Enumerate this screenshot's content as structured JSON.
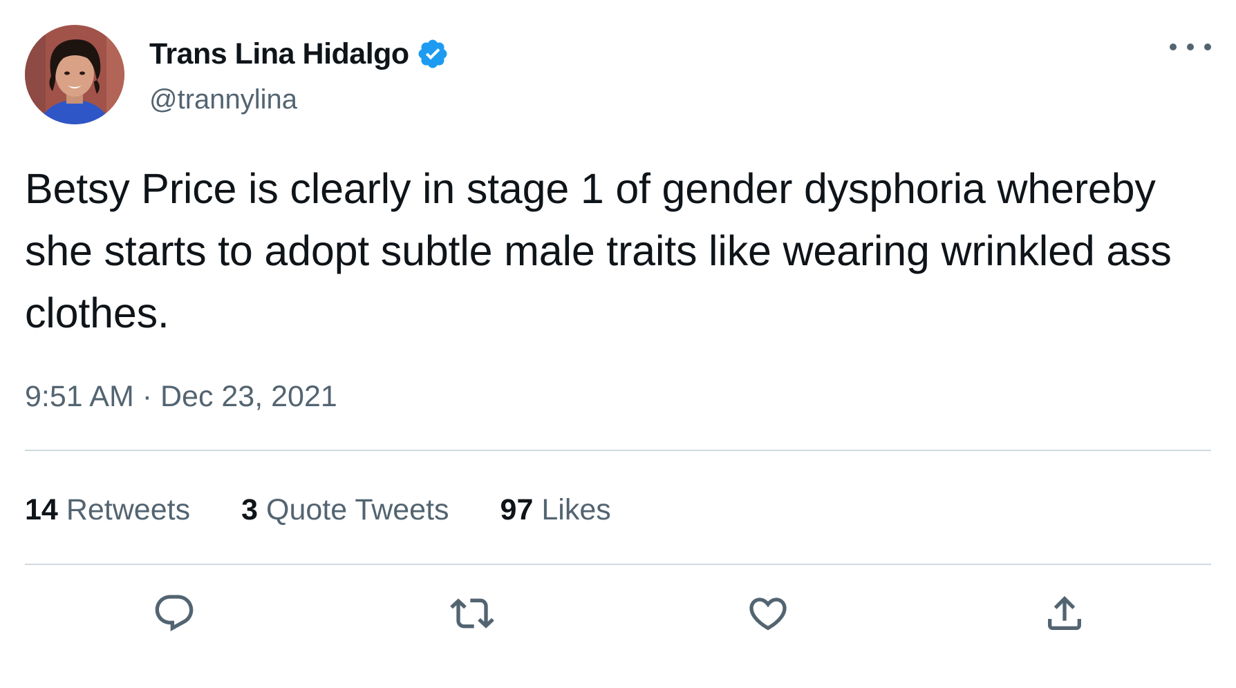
{
  "author": {
    "display_name": "Trans Lina Hidalgo",
    "handle": "@trannylina",
    "verified": true,
    "verified_color": "#1d9bf0"
  },
  "tweet": {
    "text": "Betsy Price is clearly in stage 1 of gender dysphoria whereby she starts to adopt subtle male traits like wearing wrinkled ass clothes.",
    "timestamp": "9:51 AM · Dec 23, 2021"
  },
  "stats": [
    {
      "count": "14",
      "label": "Retweets"
    },
    {
      "count": "3",
      "label": "Quote Tweets"
    },
    {
      "count": "97",
      "label": "Likes"
    }
  ],
  "actions": [
    {
      "name": "reply",
      "icon": "reply-icon"
    },
    {
      "name": "retweet",
      "icon": "retweet-icon"
    },
    {
      "name": "like",
      "icon": "heart-icon"
    },
    {
      "name": "share",
      "icon": "share-icon"
    }
  ],
  "colors": {
    "text_primary": "#0f1419",
    "text_secondary": "#536471",
    "divider": "#cfd9de",
    "accent": "#1d9bf0"
  }
}
